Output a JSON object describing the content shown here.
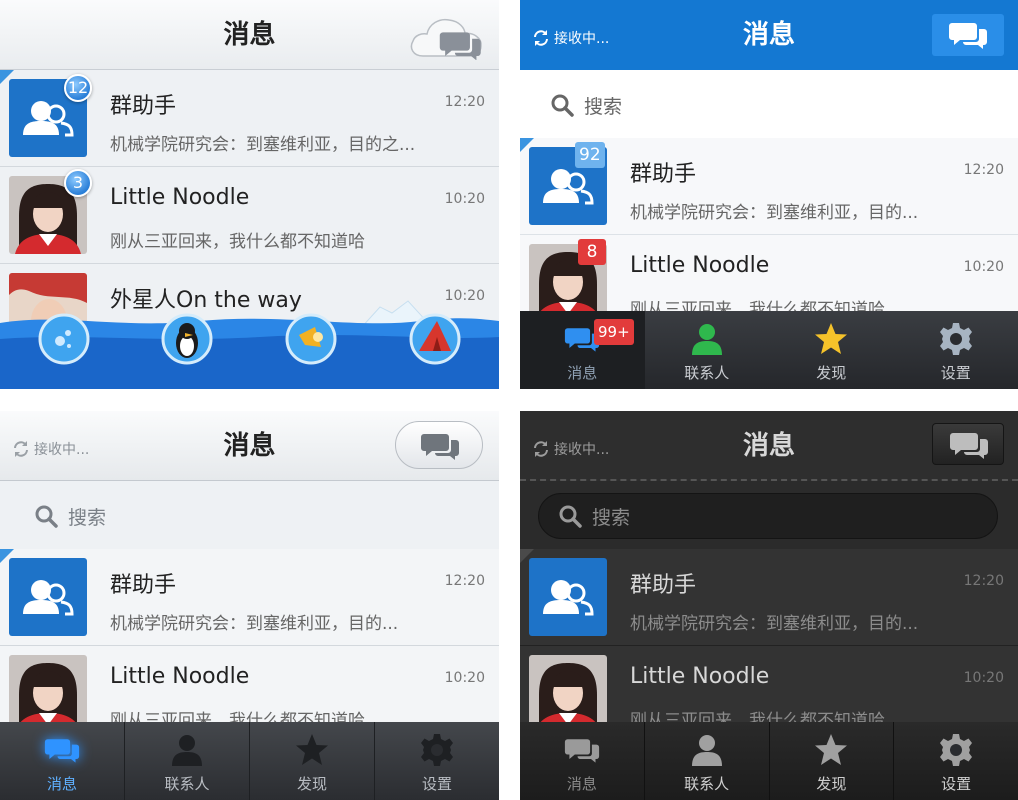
{
  "p1": {
    "title": "消息",
    "rows": [
      {
        "name": "群助手",
        "preview": "机械学院研究会：到塞维利亚，目的之...",
        "time": "12:20",
        "badge": "12"
      },
      {
        "name": "Little Noodle",
        "preview": "刚从三亚回来，我什么都不知道哈",
        "time": "10:20",
        "badge": "3"
      },
      {
        "name": "外星人On the way",
        "time": "10:20"
      }
    ]
  },
  "p2": {
    "title": "消息",
    "status": "接收中...",
    "search_placeholder": "搜索",
    "rows": [
      {
        "name": "群助手",
        "preview": "机械学院研究会：到塞维利亚，目的...",
        "time": "12:20",
        "badge": "92"
      },
      {
        "name": "Little Noodle",
        "preview": "刚从三亚回来，我什么都不知道哈",
        "time": "10:20",
        "badge": "8"
      }
    ],
    "tabs": [
      {
        "label": "消息",
        "badge": "99+"
      },
      {
        "label": "联系人"
      },
      {
        "label": "发现"
      },
      {
        "label": "设置"
      }
    ]
  },
  "p3": {
    "title": "消息",
    "status": "接收中...",
    "search_placeholder": "搜索",
    "rows": [
      {
        "name": "群助手",
        "preview": "机械学院研究会：到塞维利亚，目的...",
        "time": "12:20"
      },
      {
        "name": "Little Noodle",
        "preview": "刚从三亚回来，我什么都不知道哈",
        "time": "10:20"
      }
    ],
    "tabs": [
      {
        "label": "消息"
      },
      {
        "label": "联系人"
      },
      {
        "label": "发现"
      },
      {
        "label": "设置"
      }
    ]
  },
  "p4": {
    "title": "消息",
    "status": "接收中...",
    "search_placeholder": "搜索",
    "rows": [
      {
        "name": "群助手",
        "preview": "机械学院研究会：到塞维利亚，目的...",
        "time": "12:20"
      },
      {
        "name": "Little Noodle",
        "preview": "刚从三亚回来，我什么都不知道哈",
        "time": "10:20"
      }
    ],
    "tabs": [
      {
        "label": "消息"
      },
      {
        "label": "联系人"
      },
      {
        "label": "发现"
      },
      {
        "label": "设置"
      }
    ]
  },
  "colors": {
    "accent_blue": "#1e73c8",
    "header_blue": "#1478d2",
    "badge_red": "#e23b3b",
    "badge_light_blue": "#6fb3ee",
    "dark_bg": "#2b2b2b",
    "tabbar_dark": "#2a2c30"
  },
  "icons": {
    "group_avatar": "group-avatar-icon",
    "chat": "chat-bubbles-icon",
    "contacts": "contacts-icon",
    "discover": "star-icon",
    "settings": "gear-icon",
    "search": "search-icon",
    "sync": "refresh-icon",
    "cloud": "cloud-icon",
    "bubble": "bubble-ball-icon",
    "penguin": "penguin-ball-icon",
    "horn": "megaphone-ball-icon",
    "tent": "tent-ball-icon"
  }
}
